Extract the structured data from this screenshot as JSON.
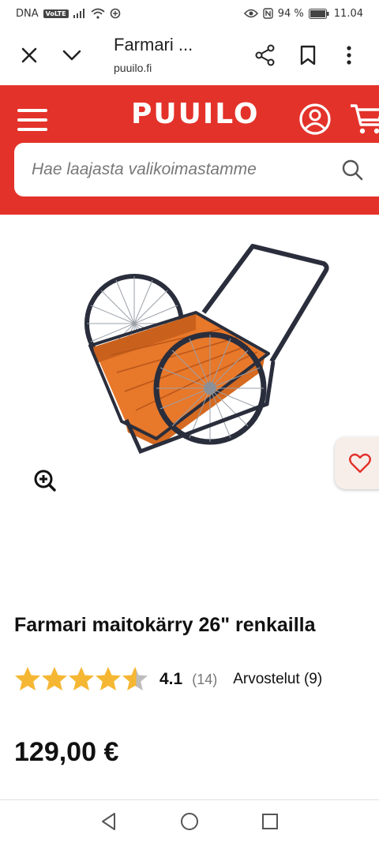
{
  "status_bar": {
    "carrier": "DNA",
    "volte": "VoLTE",
    "battery": "94 %",
    "time": "11.04"
  },
  "browser": {
    "tab_title": "Farmari ...",
    "url": "puuilo.fi",
    "icons": [
      "close-icon",
      "chevron-down-icon",
      "share-icon",
      "bookmark-icon",
      "more-vert-icon"
    ]
  },
  "header": {
    "logo": "PUUILO",
    "brand_color": "#e3322a",
    "icons": [
      "menu-icon",
      "account-icon",
      "cart-icon"
    ]
  },
  "search": {
    "placeholder": "Hae laajasta valikoimastamme"
  },
  "product": {
    "title": "Farmari maitokärry 26\" renkailla",
    "rating": "4.1",
    "rating_fraction": 0.82,
    "rating_count": "(14)",
    "reviews_label": "Arvostelut (9)",
    "price": "129,00 €",
    "star_color": "#f5b733"
  }
}
